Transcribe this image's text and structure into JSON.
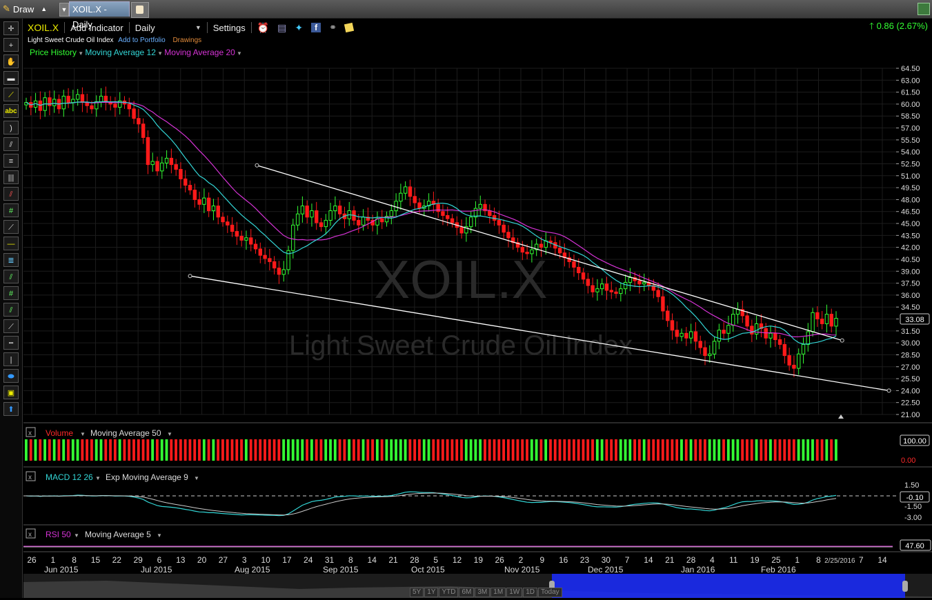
{
  "window": {
    "draw_label": "Draw",
    "tab_title": "XOIL.X - Daily"
  },
  "toolbar": {
    "symbol": "XOIL.X",
    "add_indicator": "Add Indicator",
    "interval": "Daily",
    "settings": "Settings",
    "change": "0.86 (2.67%)"
  },
  "header": {
    "name": "Light Sweet Crude Oil Index",
    "add_portfolio": "Add to Portfolio",
    "drawings": "Drawings"
  },
  "legend": {
    "price_history": "Price History",
    "ma12": "Moving Average 12",
    "ma20": "Moving Average 20"
  },
  "watermark": {
    "symbol": "XOIL.X",
    "name": "Light Sweet Crude Oil Index"
  },
  "colors": {
    "up": "#33ff33",
    "down": "#ff1a1a",
    "ma12": "#33d6d6",
    "ma20": "#d633d6",
    "change": "#33ff33"
  },
  "chart_data": [
    {
      "type": "candlestick",
      "price_axis_labels": [
        "64.50",
        "63.00",
        "61.50",
        "60.00",
        "58.50",
        "57.00",
        "55.50",
        "54.00",
        "52.50",
        "51.00",
        "49.50",
        "48.00",
        "46.50",
        "45.00",
        "43.50",
        "42.00",
        "40.50",
        "39.00",
        "37.50",
        "36.00",
        "34.50",
        "33.00",
        "31.50",
        "30.00",
        "28.50",
        "27.00",
        "25.50",
        "24.00",
        "22.50",
        "21.00"
      ],
      "ylim": [
        21.0,
        64.5
      ],
      "last_price": "33.08",
      "close_series": [
        60.2,
        59.6,
        60.4,
        59.2,
        60.8,
        59.8,
        60.6,
        59.4,
        61.0,
        60.2,
        60.6,
        61.2,
        60.2,
        59.8,
        59.4,
        60.3,
        61.0,
        60.3,
        60.0,
        59.6,
        60.4,
        60.0,
        59.4,
        58.2,
        57.5,
        55.8,
        52.4,
        52.8,
        51.6,
        52.6,
        53.2,
        52.4,
        51.8,
        50.6,
        49.8,
        49.2,
        48.0,
        47.4,
        48.2,
        46.6,
        47.2,
        45.8,
        45.2,
        44.8,
        44.0,
        43.4,
        42.9,
        43.2,
        42.4,
        41.8,
        41.0,
        40.6,
        40.2,
        39.4,
        38.6,
        39.2,
        41.6,
        44.8,
        46.2,
        47.2,
        45.8,
        46.6,
        45.1,
        44.6,
        45.4,
        46.6,
        47.2,
        46.2,
        45.6,
        46.6,
        45.4,
        44.8,
        45.8,
        45.4,
        44.8,
        45.6,
        45.2,
        45.9,
        46.6,
        47.8,
        48.8,
        49.6,
        48.4,
        47.6,
        46.9,
        47.2,
        47.8,
        47.4,
        46.5,
        46.0,
        45.6,
        45.1,
        44.5,
        43.8,
        44.6,
        45.8,
        46.9,
        47.4,
        46.6,
        46.0,
        45.4,
        44.8,
        43.9,
        43.2,
        42.6,
        42.0,
        41.4,
        41.2,
        41.7,
        42.4,
        42.0,
        42.8,
        42.6,
        41.9,
        41.3,
        40.7,
        40.2,
        39.5,
        38.8,
        38.0,
        37.2,
        36.4,
        36.8,
        37.4,
        36.6,
        36.4,
        36.2,
        36.8,
        37.6,
        38.2,
        37.8,
        37.4,
        37.6,
        37.2,
        36.6,
        35.8,
        34.0,
        32.8,
        31.6,
        30.8,
        31.2,
        30.6,
        31.4,
        30.2,
        29.4,
        28.4,
        28.6,
        30.2,
        31.6,
        31.2,
        32.2,
        33.6,
        34.2,
        33.4,
        32.1,
        31.1,
        32.4,
        31.8,
        30.6,
        31.2,
        30.4,
        29.8,
        28.4,
        27.2,
        26.8,
        28.6,
        29.8,
        31.4,
        33.8,
        33.0,
        32.4,
        33.6,
        32.1,
        33.08
      ],
      "ma12_label": "Moving Average 12",
      "ma20_label": "Moving Average 20",
      "trendlines": [
        {
          "from": {
            "date": "2015-09-03",
            "price": 52.3
          },
          "to": {
            "date": "2016-02-25",
            "price": 30.3
          }
        },
        {
          "from": {
            "date": "2015-08-14",
            "price": 38.4
          },
          "to": {
            "date": "2016-03-10",
            "price": 24.0
          }
        }
      ],
      "x_axis_ticks": [
        "26",
        "1",
        "8",
        "15",
        "22",
        "29",
        "6",
        "13",
        "20",
        "27",
        "3",
        "10",
        "17",
        "24",
        "31",
        "8",
        "14",
        "21",
        "28",
        "5",
        "12",
        "19",
        "26",
        "2",
        "9",
        "16",
        "23",
        "30",
        "7",
        "14",
        "21",
        "28",
        "4",
        "11",
        "19",
        "25",
        "1",
        "8",
        "2/25/2016",
        "7",
        "14"
      ],
      "x_axis_months": [
        "Jun 2015",
        "Jul 2015",
        "Aug 2015",
        "Sep 2015",
        "Oct 2015",
        "Nov 2015",
        "Dec 2015",
        "Jan 2016",
        "Feb 2016"
      ]
    },
    {
      "type": "bar",
      "title": "Volume",
      "overlay": "Moving Average 50",
      "axis_labels": [
        "100.00",
        "0.00"
      ]
    },
    {
      "type": "line",
      "title": "MACD 12 26",
      "overlay": "Exp Moving Average 9",
      "axis_labels": [
        "1.50",
        "-0.10",
        "-1.50",
        "-3.00"
      ],
      "last_value": "-0.10"
    },
    {
      "type": "line",
      "title": "RSI 50",
      "overlay": "Moving Average 5",
      "last_value": "47.60"
    }
  ],
  "navigator": {
    "ranges": [
      "5Y",
      "1Y",
      "YTD",
      "6M",
      "3M",
      "1M",
      "1W",
      "1D",
      "Today"
    ]
  }
}
